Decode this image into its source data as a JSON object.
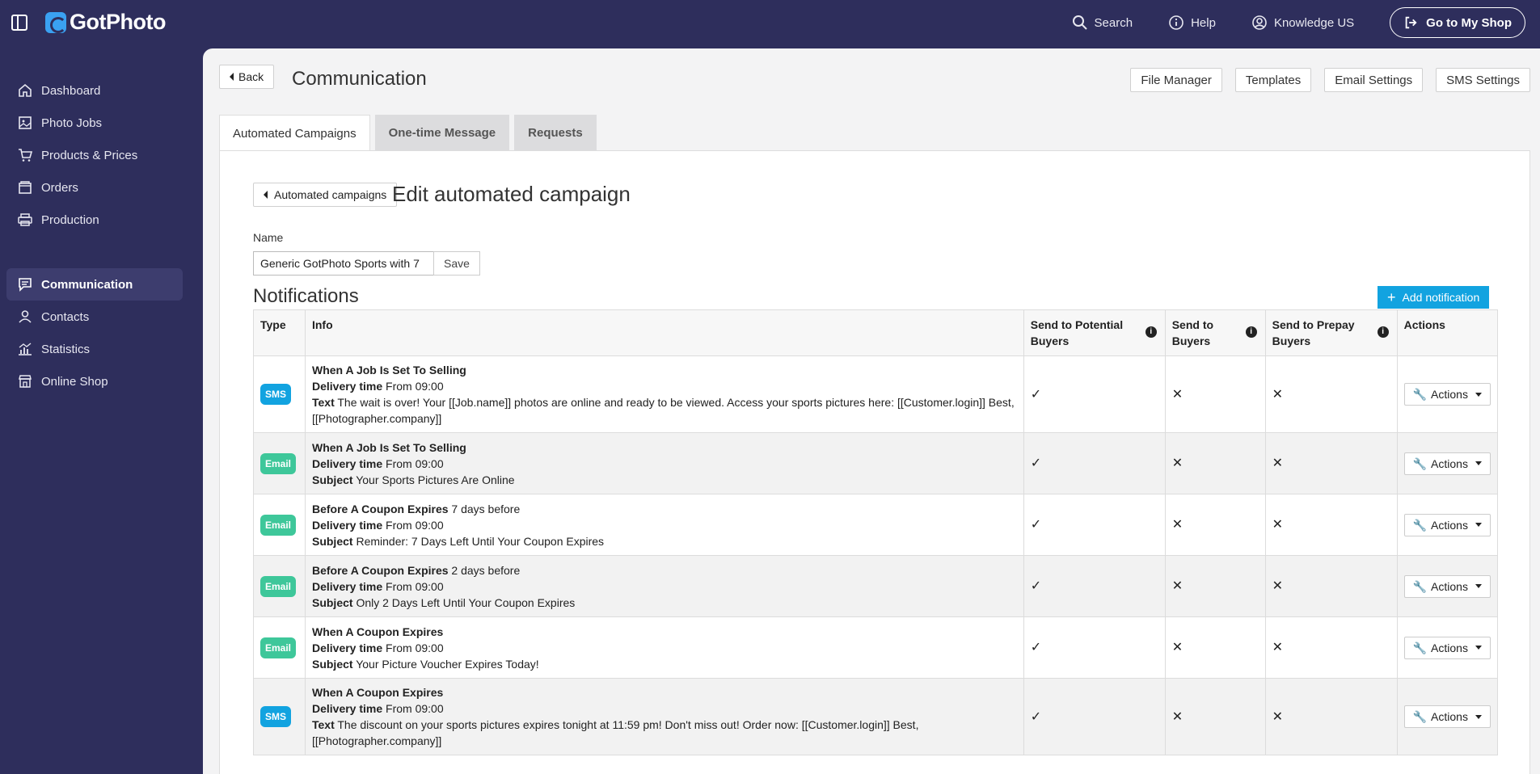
{
  "app": {
    "logo_text": "GotPhoto"
  },
  "topbar": {
    "search": "Search",
    "help": "Help",
    "account": "Knowledge US",
    "shop_button": "Go to My Shop"
  },
  "sidebar": {
    "items": [
      {
        "label": "Dashboard",
        "icon": "home-icon"
      },
      {
        "label": "Photo Jobs",
        "icon": "image-icon"
      },
      {
        "label": "Products & Prices",
        "icon": "cart-icon"
      },
      {
        "label": "Orders",
        "icon": "box-icon"
      },
      {
        "label": "Production",
        "icon": "printer-icon"
      },
      {
        "label": "Communication",
        "icon": "chat-icon",
        "active": true
      },
      {
        "label": "Contacts",
        "icon": "person-icon"
      },
      {
        "label": "Statistics",
        "icon": "chart-icon"
      },
      {
        "label": "Online Shop",
        "icon": "shop-icon"
      }
    ]
  },
  "header": {
    "back": "Back",
    "title": "Communication",
    "actions": [
      "File Manager",
      "Templates",
      "Email Settings",
      "SMS Settings"
    ]
  },
  "tabs": [
    "Automated Campaigns",
    "One-time Message",
    "Requests"
  ],
  "edit": {
    "back": "Automated campaigns",
    "title": "Edit automated campaign",
    "name_label": "Name",
    "name_value": "Generic GotPhoto Sports with 7",
    "save": "Save"
  },
  "notifications": {
    "title": "Notifications",
    "add_button": "Add notification",
    "headers": {
      "type": "Type",
      "info": "Info",
      "potential": "Send to Potential Buyers",
      "buyers": "Send to Buyers",
      "prepay": "Send to Prepay Buyers",
      "actions": "Actions"
    },
    "actions_label": "Actions",
    "rows": [
      {
        "type": "SMS",
        "event": "When A Job Is Set To Selling",
        "event_extra": "",
        "delivery_label": "Delivery time",
        "delivery": "From 09:00",
        "content_label": "Text",
        "content": "The wait is over! Your [[Job.name]] photos are online and ready to be viewed. Access your sports pictures here: [[Customer.login]] Best, [[Photographer.company]]",
        "potential": "✓",
        "buyers": "✕",
        "prepay": "✕"
      },
      {
        "type": "Email",
        "event": "When A Job Is Set To Selling",
        "event_extra": "",
        "delivery_label": "Delivery time",
        "delivery": "From 09:00",
        "content_label": "Subject",
        "content": "Your Sports Pictures Are Online",
        "potential": "✓",
        "buyers": "✕",
        "prepay": "✕"
      },
      {
        "type": "Email",
        "event": "Before A Coupon Expires",
        "event_extra": "7 days before",
        "delivery_label": "Delivery time",
        "delivery": "From 09:00",
        "content_label": "Subject",
        "content": "Reminder: 7 Days Left Until Your Coupon Expires",
        "potential": "✓",
        "buyers": "✕",
        "prepay": "✕"
      },
      {
        "type": "Email",
        "event": "Before A Coupon Expires",
        "event_extra": "2 days before",
        "delivery_label": "Delivery time",
        "delivery": "From 09:00",
        "content_label": "Subject",
        "content": "Only 2 Days Left Until Your Coupon Expires",
        "potential": "✓",
        "buyers": "✕",
        "prepay": "✕"
      },
      {
        "type": "Email",
        "event": "When A Coupon Expires",
        "event_extra": "",
        "delivery_label": "Delivery time",
        "delivery": "From 09:00",
        "content_label": "Subject",
        "content": "Your Picture Voucher Expires Today!",
        "potential": "✓",
        "buyers": "✕",
        "prepay": "✕"
      },
      {
        "type": "SMS",
        "event": "When A Coupon Expires",
        "event_extra": "",
        "delivery_label": "Delivery time",
        "delivery": "From 09:00",
        "content_label": "Text",
        "content": "The discount on your sports pictures expires tonight at 11:59 pm! Don't miss out! Order now: [[Customer.login]] Best, [[Photographer.company]]",
        "potential": "✓",
        "buyers": "✕",
        "prepay": "✕"
      }
    ]
  }
}
